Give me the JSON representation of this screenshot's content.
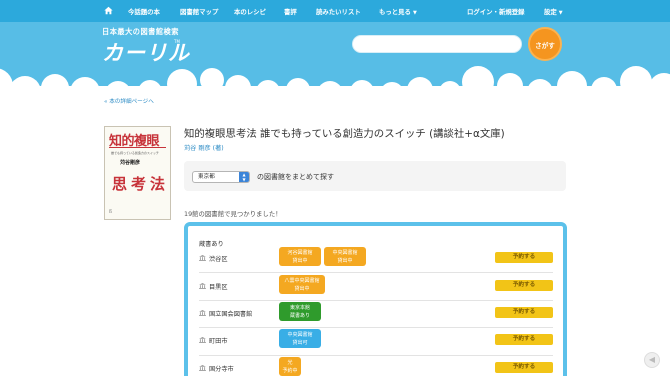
{
  "nav": {
    "items": [
      "今話題の本",
      "図書館マップ",
      "本のレシピ",
      "書評",
      "読みたいリスト",
      "もっと見る"
    ],
    "login": "ログイン・新規登録",
    "settings": "設定"
  },
  "header": {
    "tagline": "日本最大の図書館検索",
    "logo": "カーリル",
    "logo_tm": "TM",
    "search_placeholder": "",
    "search_button": "さがす"
  },
  "breadcrumb": {
    "back": "« 本の詳細ページへ"
  },
  "book": {
    "title": "知的複眼思考法 誰でも持っている創造力のスイッチ (講談社+α文庫)",
    "author": "苅谷 剛彦 (著)",
    "cover": {
      "title_top": "知的複眼",
      "subtitle": "誰でも持っている創造力のスイッチ",
      "author": "苅谷剛彦",
      "title_bottom": "思考法"
    }
  },
  "prefecture": {
    "selected": "東京都",
    "label": "の図書館をまとめて探す"
  },
  "results": {
    "found_text": "19館の図書館で見つかりました！",
    "header": "蔵書あり",
    "reserve_label": "予約する",
    "rows": [
      {
        "library": "渋谷区",
        "badges": [
          {
            "lines": [
              "河谷図書館",
              "貸出中"
            ],
            "color": "orange"
          },
          {
            "lines": [
              "中央図書館",
              "貸出中"
            ],
            "color": "orange"
          }
        ]
      },
      {
        "library": "目黒区",
        "badges": [
          {
            "lines": [
              "八雲中央図書館",
              "貸出中"
            ],
            "color": "orange"
          }
        ]
      },
      {
        "library": "国立国会図書館",
        "badges": [
          {
            "lines": [
              "東京本館",
              "蔵書あり"
            ],
            "color": "green"
          }
        ]
      },
      {
        "library": "町田市",
        "badges": [
          {
            "lines": [
              "中央図書館",
              "貸出可"
            ],
            "color": "blue"
          }
        ]
      },
      {
        "library": "国分寺市",
        "badges": [
          {
            "lines": [
              "光",
              "予約中"
            ],
            "color": "orange"
          }
        ]
      }
    ]
  },
  "colors": {
    "nav_bg": "#2ca9dc",
    "header_bg": "#57bde6",
    "search_button": "#f5951f",
    "results_border": "#5cc1ea",
    "reserve_button": "#f2c417"
  }
}
